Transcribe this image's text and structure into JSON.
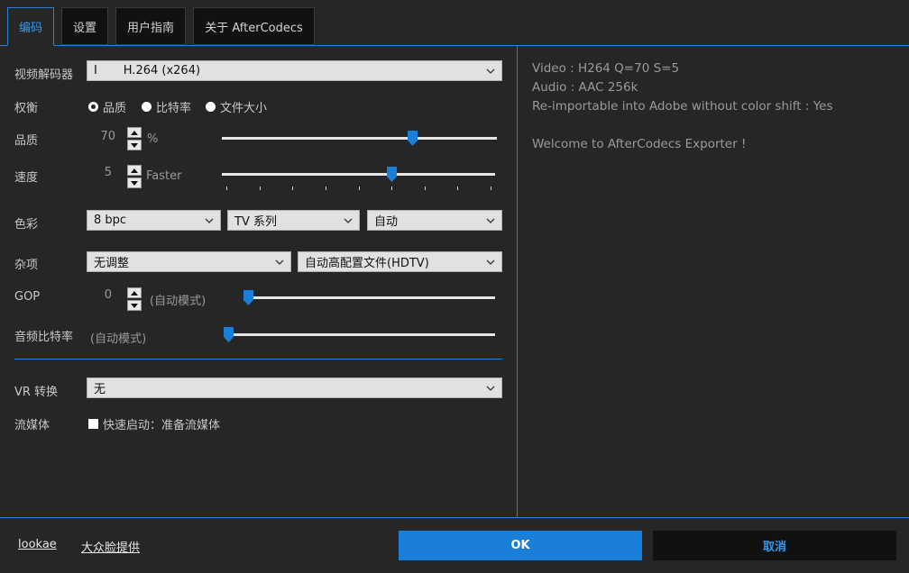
{
  "tabs": [
    {
      "label": "编码",
      "active": true
    },
    {
      "label": "设置",
      "active": false
    },
    {
      "label": "用户指南",
      "active": false
    },
    {
      "label": "关于 AfterCodecs",
      "active": false
    }
  ],
  "encoder": {
    "label": "视频解码器",
    "value": "I       H.264 (x264)"
  },
  "tradeoff": {
    "label": "权衡",
    "options": [
      "品质",
      "比特率",
      "文件大小"
    ],
    "selected": "品质"
  },
  "quality": {
    "label": "品质",
    "value": "70",
    "unit": "%",
    "slider_fraction": 0.7
  },
  "speed": {
    "label": "速度",
    "value": "5",
    "unit": "Faster",
    "slider_fraction": 0.625,
    "tick_count": 9
  },
  "color": {
    "label": "色彩",
    "depth": "8 bpc",
    "range": "TV 系列",
    "matrix": "自动"
  },
  "misc": {
    "label": "杂项",
    "tuning": "无调整",
    "profile": "自动高配置文件(HDTV)"
  },
  "gop": {
    "label": "GOP",
    "value": "0",
    "mode": "(自动模式)",
    "slider_fraction": 0.0
  },
  "audio_bitrate": {
    "label": "音频比特率",
    "mode": "(自动模式)",
    "slider_fraction": 0.0
  },
  "vr": {
    "label": "VR 转换",
    "value": "无"
  },
  "streaming": {
    "label": "流媒体",
    "checkbox_label": "快速启动：准备流媒体",
    "checked": false
  },
  "info_panel": {
    "video": "Video : H264 Q=70 S=5",
    "audio": "Audio : AAC 256k",
    "reimport": "Re-importable into Adobe without color shift : Yes",
    "welcome": "Welcome to AfterCodecs Exporter !"
  },
  "footer": {
    "link1": "lookae",
    "link2": "大众脸提供",
    "ok": "OK",
    "cancel": "取消"
  },
  "colors": {
    "accent": "#1a7fd9",
    "background": "#262626",
    "tab_bg": "#111111"
  }
}
